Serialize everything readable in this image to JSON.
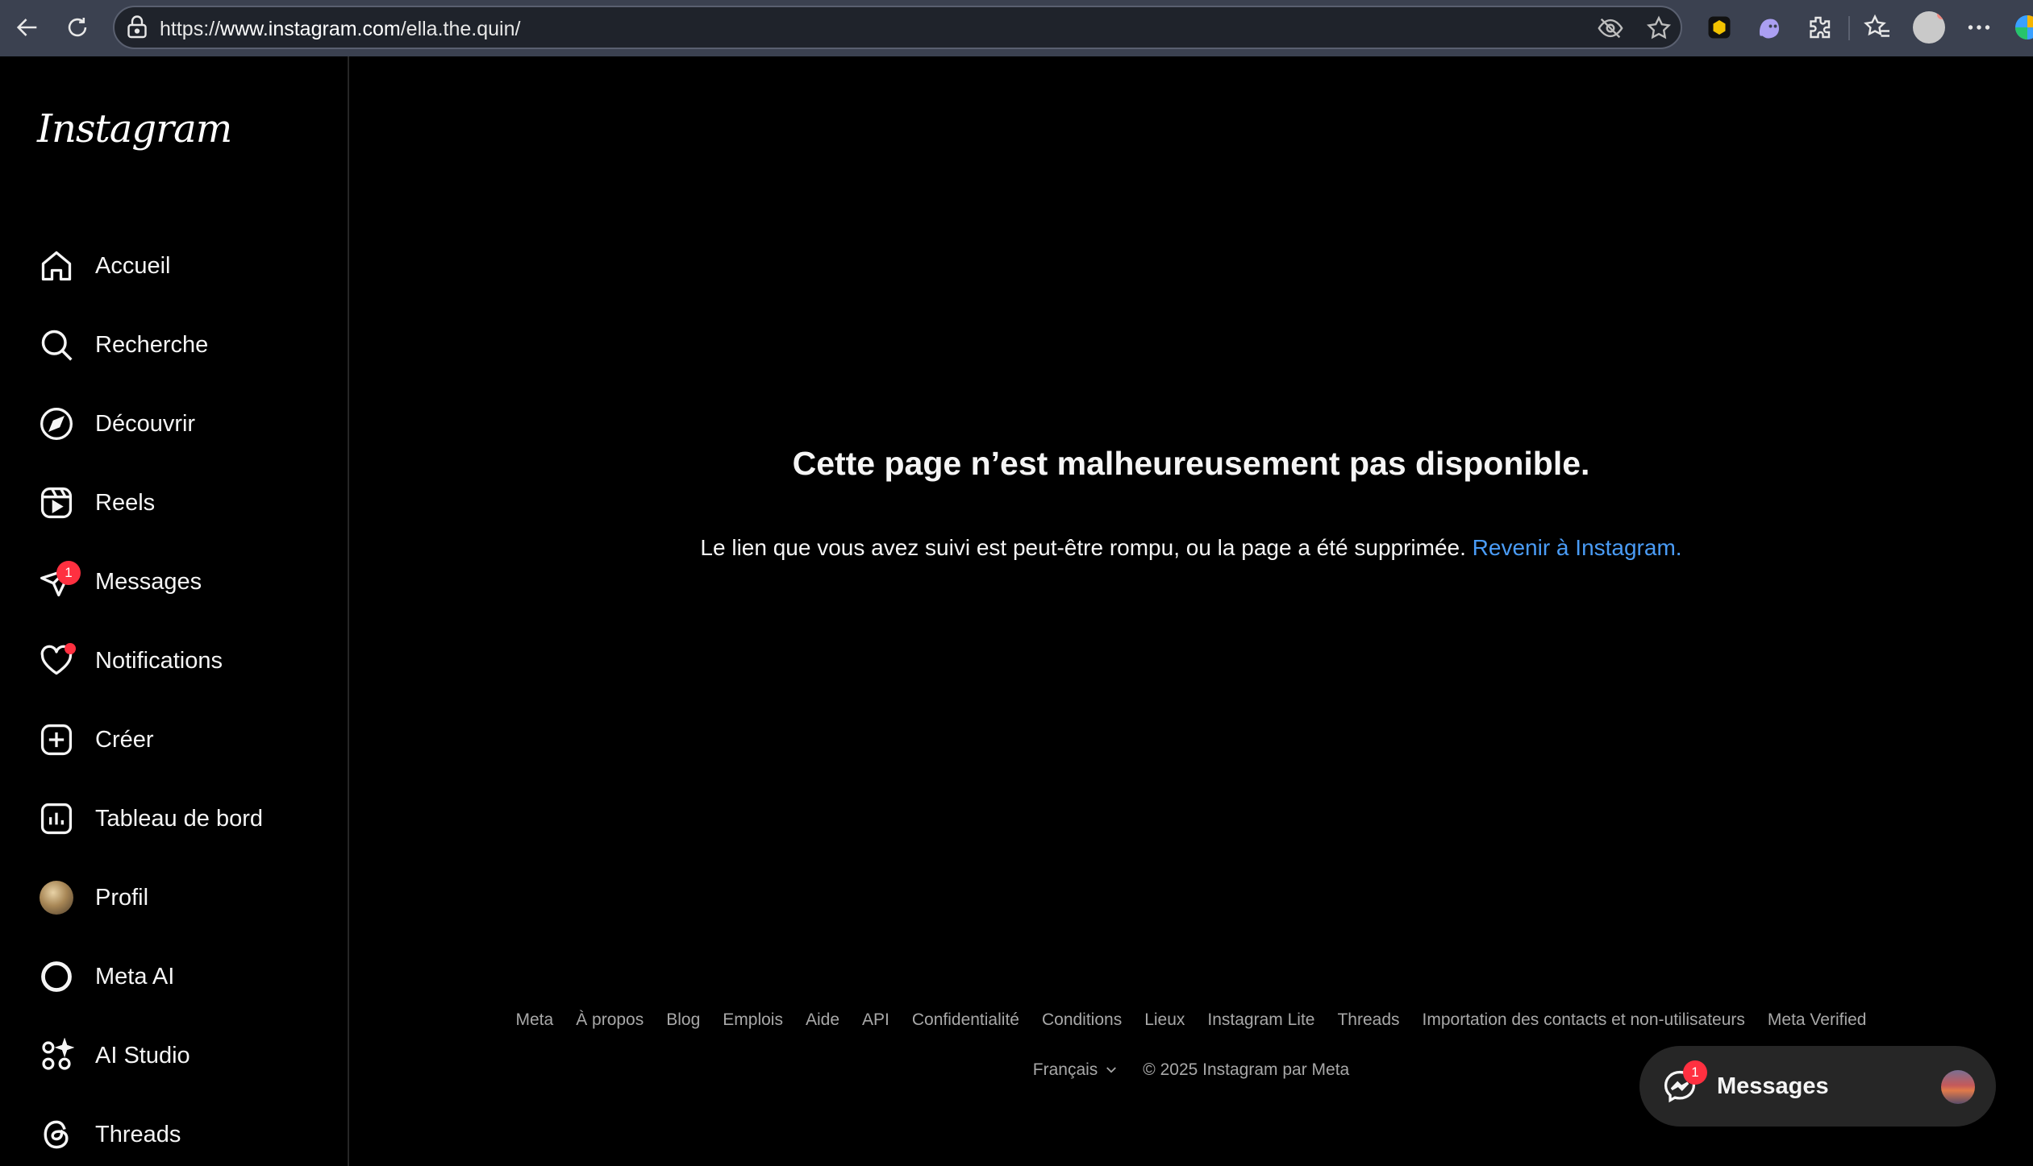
{
  "browser": {
    "url_prefix": "https://",
    "url_host": "www.instagram.com",
    "url_path": "/ella.the.quin/"
  },
  "sidebar": {
    "logo": "Instagram",
    "items": [
      {
        "label": "Accueil",
        "icon": "home-icon"
      },
      {
        "label": "Recherche",
        "icon": "search-icon"
      },
      {
        "label": "Découvrir",
        "icon": "compass-icon"
      },
      {
        "label": "Reels",
        "icon": "reels-icon"
      },
      {
        "label": "Messages",
        "icon": "direct-icon",
        "badge": "1"
      },
      {
        "label": "Notifications",
        "icon": "heart-icon"
      },
      {
        "label": "Créer",
        "icon": "plus-square-icon"
      },
      {
        "label": "Tableau de bord",
        "icon": "dashboard-icon"
      },
      {
        "label": "Profil",
        "icon": "avatar"
      },
      {
        "label": "Meta AI",
        "icon": "meta-ai-icon"
      },
      {
        "label": "AI Studio",
        "icon": "ai-studio-icon"
      },
      {
        "label": "Threads",
        "icon": "threads-icon"
      }
    ]
  },
  "main": {
    "title": "Cette page n’est malheureusement pas disponible.",
    "message": "Le lien que vous avez suivi est peut-être rompu, ou la page a été supprimée.",
    "link": "Revenir à Instagram."
  },
  "footer": {
    "links": [
      "Meta",
      "À propos",
      "Blog",
      "Emplois",
      "Aide",
      "API",
      "Confidentialité",
      "Conditions",
      "Lieux",
      "Instagram Lite",
      "Threads",
      "Importation des contacts et non-utilisateurs",
      "Meta Verified"
    ],
    "language": "Français",
    "copyright": "© 2025 Instagram par Meta"
  },
  "messages_pill": {
    "label": "Messages",
    "badge": "1"
  },
  "colors": {
    "background": "#000000",
    "link": "#4a9cf6",
    "badge": "#ff3040",
    "chrome": "#3b4150"
  }
}
